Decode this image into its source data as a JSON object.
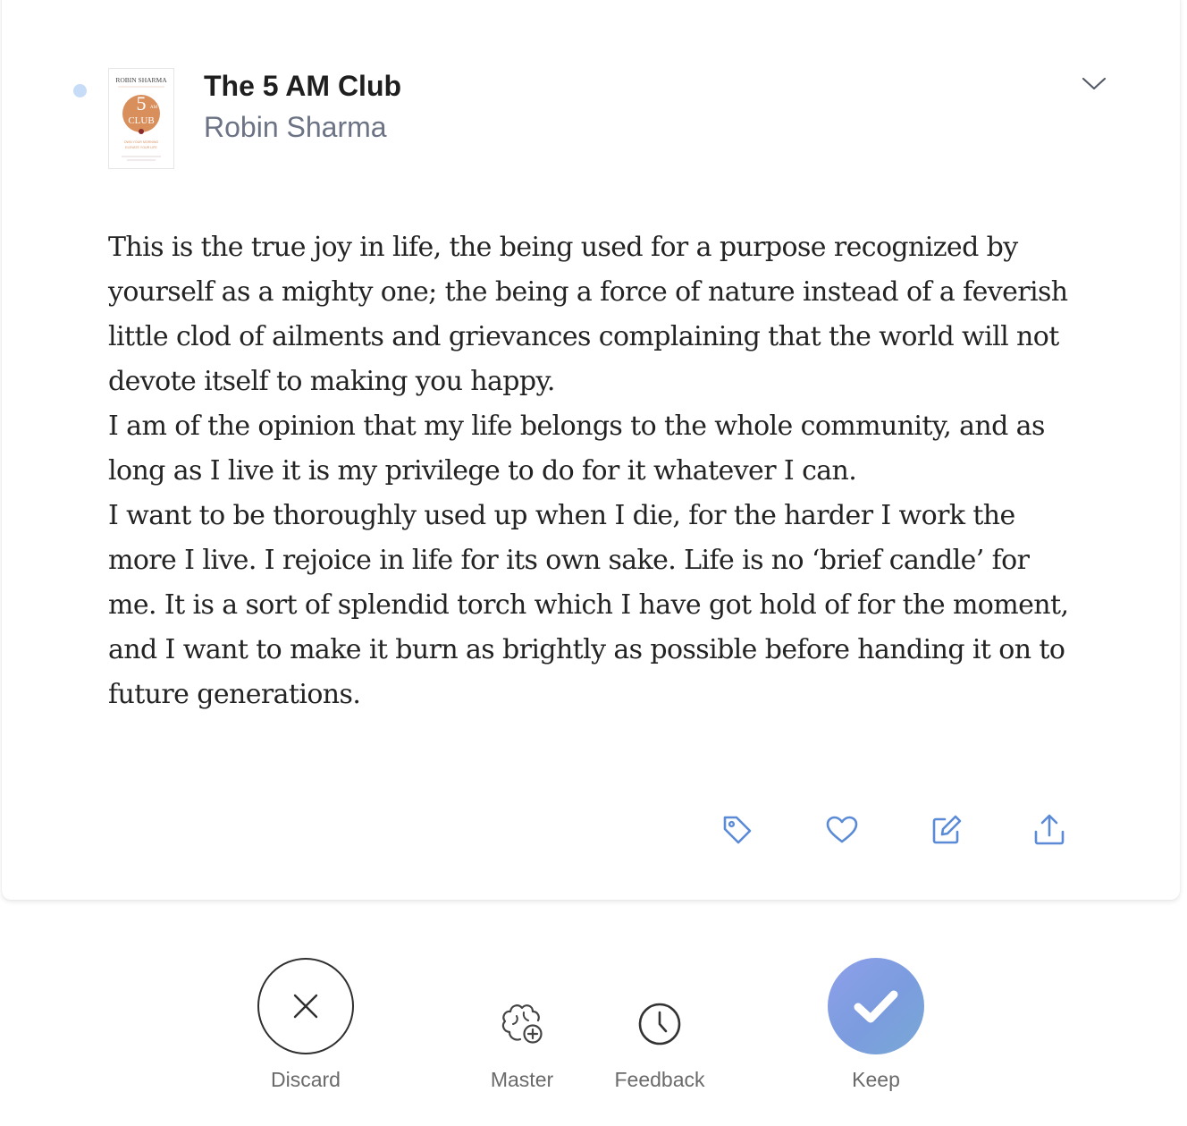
{
  "book": {
    "title": "The 5 AM Club",
    "author": "Robin Sharma",
    "cover": {
      "author_text": "ROBIN SHARMA",
      "number_text": "5",
      "am_text": "AM",
      "club_text": "CLUB",
      "tagline_1": "OWN YOUR MORNING",
      "tagline_2": "ELEVATE YOUR LIFE",
      "accent_color": "#d98f5c"
    }
  },
  "unread_dot_color": "#c6dcf7",
  "quote": {
    "paragraphs": [
      "This is the true joy in life, the being used for a purpose recognized by yourself as a mighty one; the being a force of nature instead of a feverish little clod of ailments and grievances complaining that the world will not devote itself to making you happy.",
      "I am of the opinion that my life belongs to the whole community, and as long as I live it is my privilege to do for it whatever I can.",
      "I want to be thoroughly used up when I die, for the harder I work the more I live. I rejoice in life for its own sake. Life is no ‘brief candle’ for me. It is a sort of splendid torch which I have got hold of for the moment, and I want to make it burn as brightly as possible before handing it on to future generations."
    ]
  },
  "card_actions": [
    {
      "name": "tag-icon",
      "color": "#5b8bd6"
    },
    {
      "name": "heart-icon",
      "color": "#5b8bd6"
    },
    {
      "name": "edit-icon",
      "color": "#5b8bd6"
    },
    {
      "name": "share-icon",
      "color": "#5b8bd6"
    }
  ],
  "bottom_bar": {
    "discard_label": "Discard",
    "master_label": "Master",
    "feedback_label": "Feedback",
    "keep_label": "Keep"
  },
  "colors": {
    "accent_blue": "#5b8bd6",
    "keep_gradient_start": "#8ea0ea",
    "keep_gradient_end": "#7aa9d6",
    "text_primary": "#232323",
    "text_secondary": "#6b7384"
  }
}
